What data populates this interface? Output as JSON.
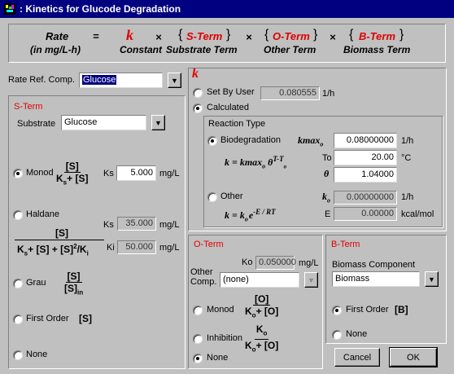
{
  "window": {
    "title": ": Kinetics for Glucode Degradation"
  },
  "header": {
    "rate": "Rate",
    "rate_units": "(in mg/L-h)",
    "equals": "=",
    "k": "k",
    "k_label": "Constant",
    "times": "×",
    "s_term": "S-Term",
    "s_term_label": "Substrate Term",
    "o_term": "O-Term",
    "o_term_label": "Other Term",
    "b_term": "B-Term",
    "b_term_label": "Biomass Term",
    "lbrace": "{",
    "rbrace": "}"
  },
  "rate_ref": {
    "label": "Rate Ref. Comp.",
    "value": "Glucose"
  },
  "s_term": {
    "title": "S-Term",
    "substrate_label": "Substrate",
    "substrate_value": "Glucose",
    "monod": {
      "label": "Monod",
      "num": "[S]",
      "den_a": "K",
      "den_sub": "s",
      "den_b": "+ [S]",
      "ks_label": "Ks",
      "ks_value": "5.000",
      "unit": "mg/L"
    },
    "haldane": {
      "label": "Haldane",
      "num": "[S]",
      "ks_label": "Ks",
      "ks_value": "35.000",
      "ki_label": "Ki",
      "ki_value": "50.000",
      "unit": "mg/L",
      "den_1": "K",
      "den_1_sub": "s",
      "den_2": "+ [S] + [S]",
      "den_sup": "2",
      "den_3": "/K",
      "den_3_sub": "i"
    },
    "grau": {
      "label": "Grau",
      "num": "[S]",
      "den": "[S]",
      "den_sub": "in"
    },
    "first_order": {
      "label": "First Order",
      "expr": "[S]"
    },
    "none": {
      "label": "None"
    },
    "selected": "monod"
  },
  "k": {
    "title": "k",
    "set_by_user": {
      "label": "Set By User",
      "value": "0.080555",
      "unit": "1/h"
    },
    "calculated": {
      "label": "Calculated"
    },
    "selected": "calculated",
    "reaction_type": {
      "title": "Reaction Type",
      "biodeg": {
        "label": "Biodegradation",
        "kmax_label": "kmax",
        "kmax_sub": "o",
        "kmax_value": "0.08000000",
        "kmax_unit": "1/h",
        "formula": "k = kmax",
        "formula_sub": "o",
        "formula_theta": "θ",
        "formula_exp": "T-T",
        "formula_exp_sub": "o",
        "to_label": "To",
        "to_value": "20.00",
        "to_unit": "°C",
        "theta_label": "θ",
        "theta_value": "1.04000"
      },
      "other": {
        "label": "Other",
        "ko_label": "k",
        "ko_sub": "o",
        "ko_value": "0.00000000",
        "ko_unit": "1/h",
        "formula": "k = k",
        "formula_sub": "o",
        "formula_e": "e",
        "formula_exp": "-E / RT",
        "e_label": "E",
        "e_value": "0.00000",
        "e_unit": "kcal/mol"
      },
      "selected": "biodeg"
    }
  },
  "o_term": {
    "title": "O-Term",
    "ko_label": "Ko",
    "ko_value": "0.050000",
    "ko_unit": "mg/L",
    "other_comp_label_1": "Other",
    "other_comp_label_2": "Comp.",
    "other_comp_value": "(none)",
    "monod": {
      "label": "Monod",
      "num": "[O]",
      "den_a": "K",
      "den_sub": "o",
      "den_b": "+ [O]"
    },
    "inhibition": {
      "label": "Inhibition",
      "num": "K",
      "num_sub": "o",
      "den_a": "K",
      "den_sub": "o",
      "den_b": "+ [O]"
    },
    "none": {
      "label": "None"
    },
    "selected": "none"
  },
  "b_term": {
    "title": "B-Term",
    "biomass_label": "Biomass Component",
    "biomass_value": "Biomass",
    "first_order": {
      "label": "First Order",
      "expr": "[B]"
    },
    "none": {
      "label": "None"
    },
    "selected": "first_order"
  },
  "buttons": {
    "cancel": "Cancel",
    "ok": "OK"
  },
  "colors": {
    "accent_red": "#e00000",
    "title_bar": "#000080",
    "face": "#c0c0c0"
  }
}
